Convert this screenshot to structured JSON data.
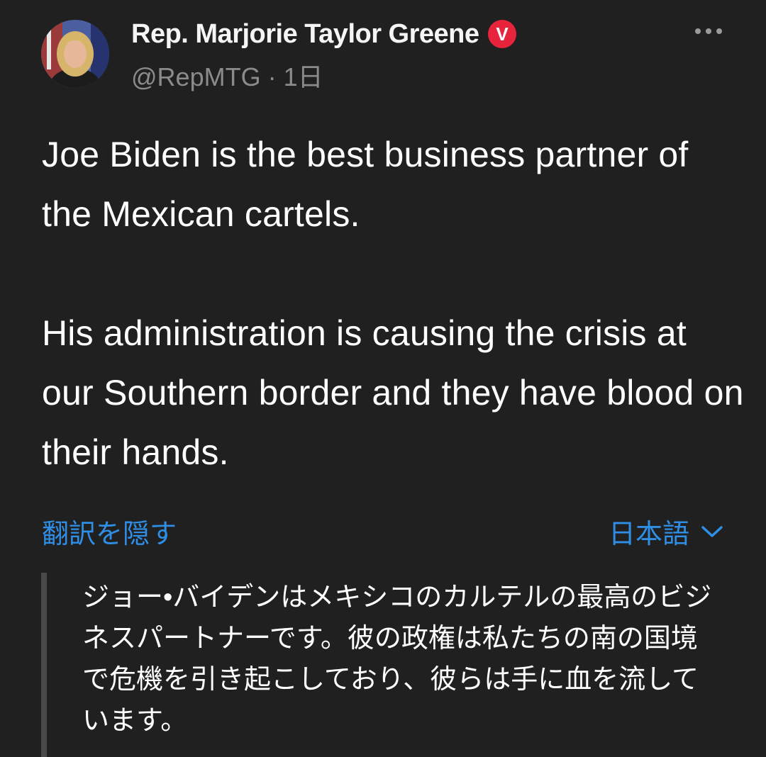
{
  "author": {
    "display_name": "Rep. Marjorie Taylor Greene",
    "handle": "@RepMTG",
    "separator": "·",
    "time": "1日",
    "badge_label": "V",
    "badge_color": "#e8243d"
  },
  "menu": {
    "icon": "more-horizontal-icon"
  },
  "tweet": {
    "paragraphs": [
      "Joe Biden is the best business partner of the Mexican cartels.",
      "His administration is causing the crisis at our Southern border and they have blood on their hands."
    ]
  },
  "translation": {
    "hide_label": "翻訳を隠す",
    "language_label": "日本語",
    "language_icon": "chevron-down-icon",
    "text": "ジョー•バイデンはメキシコのカルテルの最高のビジネスパートナーです。彼の政権は私たちの南の国境で危機を引き起こしており、彼らは手に血を流しています。",
    "link_color": "#2f8fe6"
  }
}
